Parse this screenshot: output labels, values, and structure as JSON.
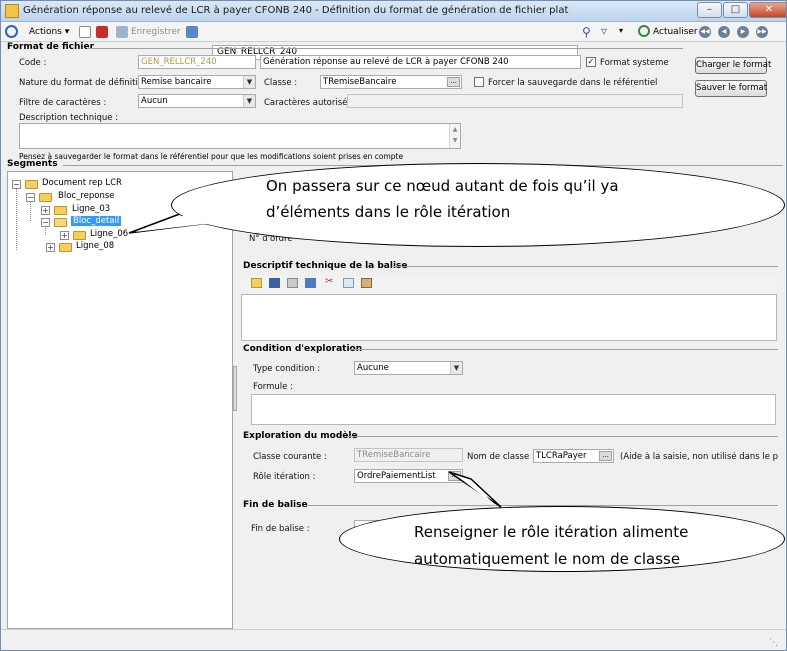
{
  "window": {
    "title": "Génération réponse au relevé de LCR à payer CFONB 240 -  Définition du format de génération de fichier plat"
  },
  "toolbar": {
    "actions_label": "Actions",
    "save_label": "Enregistrer",
    "record_value": "GEN_RELLCR_240",
    "refresh_label": "Actualiser"
  },
  "format_fichier": {
    "section_title": "Format de fichier",
    "code_label": "Code :",
    "code_value": "GEN_RELLCR_240",
    "description_value": "Génération réponse au relevé de LCR à payer CFONB 240",
    "system_format_label": "Format systeme",
    "nature_label": "Nature du format de définition :",
    "nature_value": "Remise bancaire",
    "classe_label": "Classe :",
    "classe_value": "TRemiseBancaire",
    "force_save_label": "Forcer la sauvegarde dans le référentiel",
    "filtre_label": "Filtre de caractères :",
    "filtre_value": "Aucun",
    "allowed_chars_label": "Caractères autorisés :",
    "tech_desc_label": "Description technique :",
    "reminder_text": "Pensez à sauvegarder le format dans le référentiel pour que les modifications soient prises en compte",
    "load_button": "Charger le format",
    "save_button": "Sauver le format"
  },
  "segments": {
    "section_title": "Segments",
    "tree": [
      {
        "label": "Document rep LCR"
      },
      {
        "label": "Bloc_reponse"
      },
      {
        "label": "Ligne_03"
      },
      {
        "label": "Bloc_detail"
      },
      {
        "label": "Ligne_06"
      },
      {
        "label": "Ligne_08"
      }
    ]
  },
  "detail": {
    "order_label": "N° d'ordre",
    "tech_desc_title": "Descriptif technique de la balise",
    "exploration_title": "Condition d'exploration",
    "type_condition_label": "Type condition :",
    "type_condition_value": "Aucune",
    "formule_label": "Formule :",
    "model_title": "Exploration du modèle",
    "current_class_label": "Classe courante :",
    "current_class_value": "TRemiseBancaire",
    "class_name_label": "Nom de classe :",
    "class_name_value": "TLCRaPayer",
    "help_text": "(Aide à la saisie, non utilisé dans le proces",
    "role_label": "Rôle itération :",
    "role_value": "OrdrePaiementList",
    "end_title": "Fin de balise",
    "end_label": "Fin de balise :"
  },
  "callouts": {
    "top_line1": "On passera sur ce nœud autant de fois qu’il ya",
    "top_line2": "d’éléments dans le rôle itération",
    "bottom_line1": "Renseigner  le rôle itération alimente",
    "bottom_line2": "automatiquement  le nom de classe"
  }
}
